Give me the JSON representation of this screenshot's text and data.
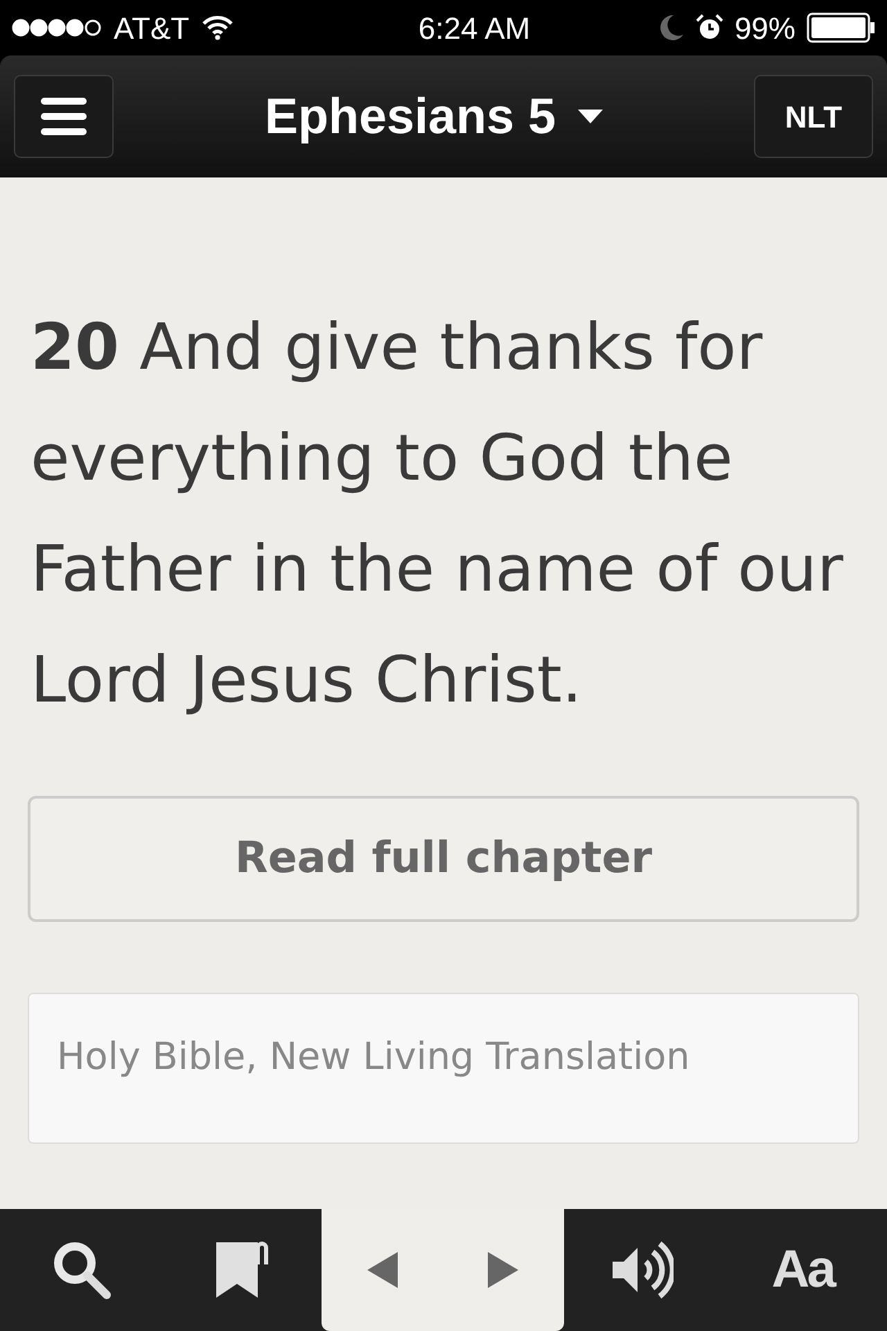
{
  "status_bar": {
    "carrier": "AT&T",
    "time": "6:24 AM",
    "battery": "99%"
  },
  "header": {
    "title": "Ephesians 5",
    "version": "NLT"
  },
  "verse": "**20** And give thanks for everything to God the Father in the name of our Lord Jesus Christ.",
  "read_button": "Read full chapter",
  "copyright": "Holy Bible, New Living Translation",
  "toolbar": {
    "font_button": "Aa"
  }
}
